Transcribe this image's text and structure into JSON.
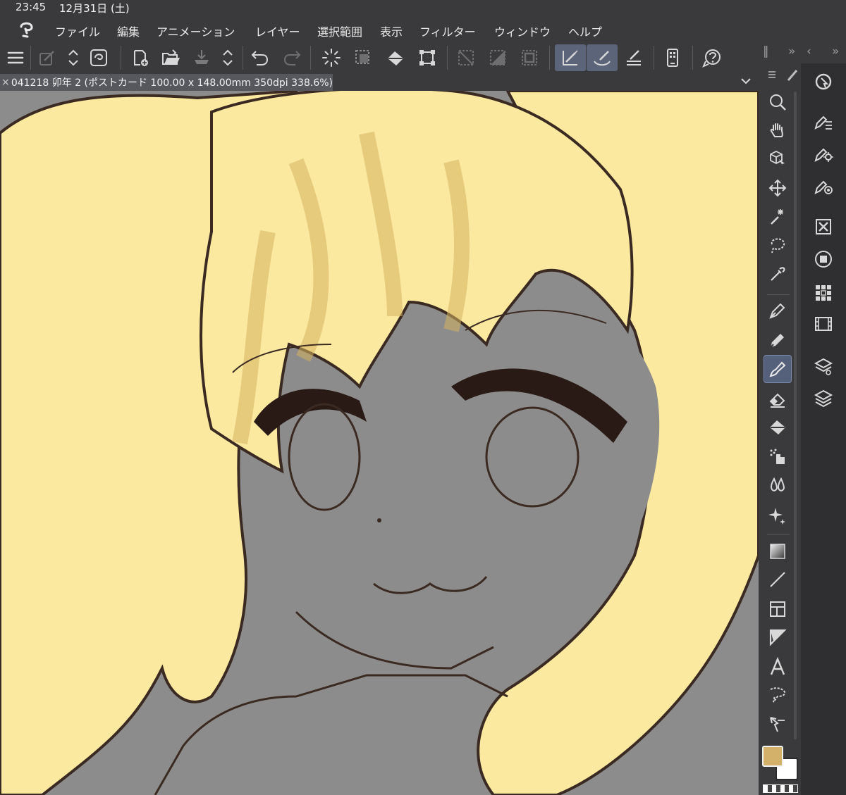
{
  "status": {
    "time": "23:45",
    "date": "12月31日 (土)"
  },
  "menu": [
    {
      "label": "ファイル"
    },
    {
      "label": "編集"
    },
    {
      "label": "アニメーション"
    },
    {
      "label": "レイヤー"
    },
    {
      "label": "選択範囲"
    },
    {
      "label": "表示"
    },
    {
      "label": "フィルター"
    },
    {
      "label": "ウィンドウ"
    },
    {
      "label": "ヘルプ"
    }
  ],
  "tab": {
    "close": "×",
    "title": "041218 卯年 2 (ポストカード 100.00 x 148.00mm 350dpi 338.6%)"
  },
  "colors": {
    "main": "#d4b16a",
    "sub": "#ffffff",
    "canvas_bg": "#8c8c8c",
    "hair": "#fbe9a0",
    "hair_shade": "#d6b35e",
    "line": "#3a2a22",
    "active_tool": "#55607a"
  },
  "icons": {
    "toolbar": [
      "menu-icon",
      "edit-icon",
      "stepper-icon",
      "clip-icon",
      "new-canvas-icon",
      "open-icon",
      "save-icon",
      "stepper-icon",
      "undo-icon",
      "redo-icon",
      "deselect-icon",
      "select-all-icon",
      "fill-icon",
      "transform-icon",
      "clear-outside-icon",
      "fill-selection-icon",
      "selection-border-icon",
      "ruler-snap-icon",
      "brush-snap-icon",
      "baseline-snap-icon",
      "smartphone-icon",
      "help-icon"
    ],
    "tools": [
      "zoom-icon",
      "hand-icon",
      "object-icon",
      "move-icon",
      "auto-select-icon",
      "lasso-icon",
      "eyedropper-icon",
      "pen-icon",
      "pencil-icon",
      "brush-icon",
      "eraser-icon",
      "fill-icon",
      "airbrush-icon",
      "blend-icon",
      "decoration-icon",
      "gradient-icon",
      "line-icon",
      "frame-icon",
      "ruler-icon",
      "text-icon",
      "balloon-icon",
      "correct-line-icon"
    ]
  }
}
